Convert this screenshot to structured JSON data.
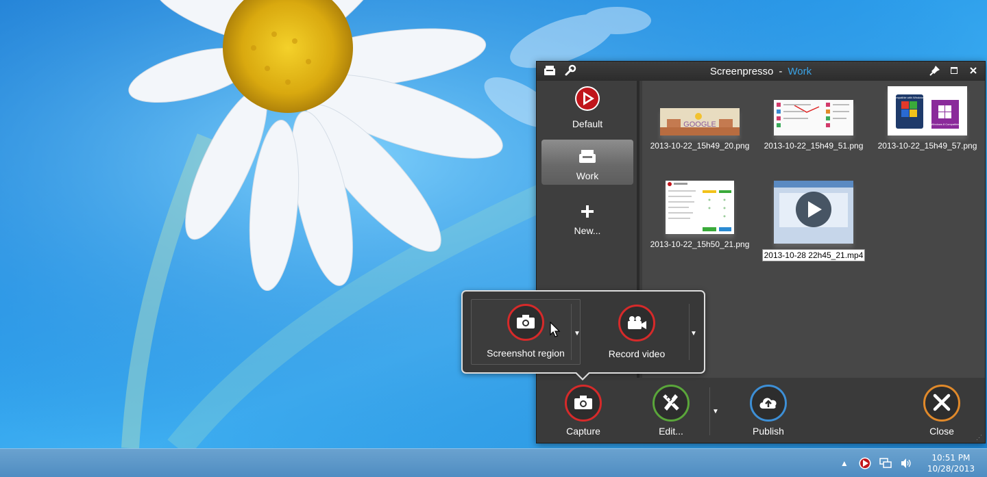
{
  "window": {
    "app_name": "Screenpresso",
    "separator": "-",
    "workspace_name": "Work"
  },
  "sidebar": {
    "items": [
      {
        "label": "Default"
      },
      {
        "label": "Work"
      },
      {
        "label": "New..."
      }
    ]
  },
  "gallery": {
    "files": [
      {
        "name": "2013-10-22_15h49_20.png"
      },
      {
        "name": "2013-10-22_15h49_51.png"
      },
      {
        "name": "2013-10-22_15h49_57.png"
      },
      {
        "name": "2013-10-22_15h50_21.png"
      },
      {
        "name": "2013-10-28 22h45_21.mp4"
      }
    ],
    "thumb_texts": {
      "google": "GOOGLE",
      "win7": "Compatible with Windows 7",
      "win8": "Windows 8 Compatible"
    }
  },
  "popup": {
    "screenshot_label": "Screenshot region",
    "video_label": "Record video"
  },
  "toolbar": {
    "capture_label": "Capture",
    "edit_label": "Edit...",
    "publish_label": "Publish",
    "close_label": "Close"
  },
  "taskbar": {
    "time": "10:51 PM",
    "date": "10/28/2013"
  },
  "colors": {
    "capture_ring": "#d62a2a",
    "edit_ring": "#5aa63a",
    "publish_ring": "#3d8fd6",
    "close_ring": "#e0892a",
    "workspace_accent": "#3aa3e6"
  }
}
